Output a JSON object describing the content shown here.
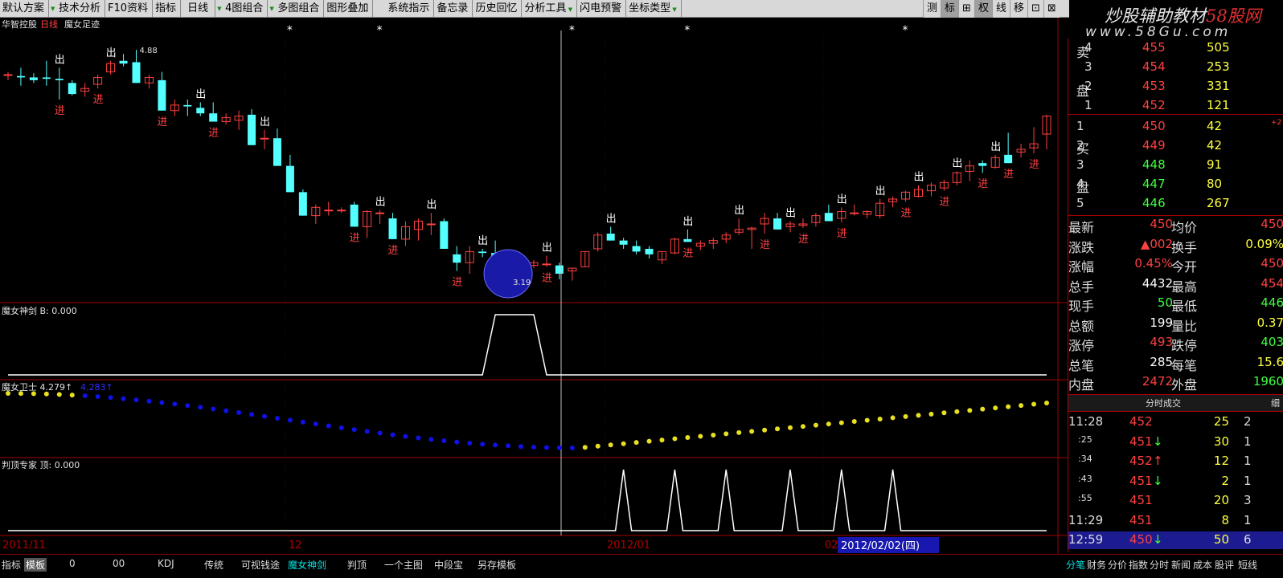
{
  "toolbar": {
    "items": [
      "默认方案",
      "技术分析",
      "F10资料",
      "指标",
      "日线",
      "4图组合",
      "多图组合",
      "图形叠加",
      "系统指示",
      "备忘录",
      "历史回忆",
      "分析工具",
      "闪电预警",
      "坐标类型"
    ],
    "right": [
      "测",
      "标",
      "⊞",
      "权",
      "线",
      "移",
      "⊡",
      "⊠"
    ]
  },
  "brand": {
    "line1a": "炒股辅助教材",
    "line1b": "58股网",
    "line2": "www.58Gu.com"
  },
  "chart": {
    "stock_name": "华智控股",
    "period": "日线",
    "indicator_main": "魔女足迹",
    "high_label": "4.88",
    "low_label": "3.19",
    "panel2_label": "魔女神剑 B: 0.000",
    "panel3_label": "魔女卫士 4.279↑",
    "panel3_label2": "4.283↑",
    "panel4_label": "判顶专家 顶: 0.000",
    "x_labels": [
      "2011/11",
      "12",
      "2012/01",
      "02"
    ],
    "cursor_date": "2012/02/02(四)",
    "out_label": "出",
    "in_label": "进",
    "star_label": "*"
  },
  "chart_data": {
    "type": "candlestick",
    "ohlc": [
      [
        4.7,
        4.72,
        4.66,
        4.7
      ],
      [
        4.69,
        4.75,
        4.62,
        4.68
      ],
      [
        4.68,
        4.71,
        4.64,
        4.66
      ],
      [
        4.68,
        4.8,
        4.62,
        4.67
      ],
      [
        4.67,
        4.75,
        4.52,
        4.66
      ],
      [
        4.64,
        4.66,
        4.55,
        4.56
      ],
      [
        4.58,
        4.64,
        4.54,
        4.6
      ],
      [
        4.63,
        4.7,
        4.6,
        4.68
      ],
      [
        4.72,
        4.8,
        4.7,
        4.78
      ],
      [
        4.8,
        4.85,
        4.76,
        4.78
      ],
      [
        4.79,
        4.88,
        4.64,
        4.64
      ],
      [
        4.64,
        4.7,
        4.6,
        4.68
      ],
      [
        4.66,
        4.72,
        4.44,
        4.44
      ],
      [
        4.44,
        4.52,
        4.4,
        4.48
      ],
      [
        4.48,
        4.52,
        4.4,
        4.47
      ],
      [
        4.46,
        4.5,
        4.4,
        4.42
      ],
      [
        4.42,
        4.5,
        4.36,
        4.36
      ],
      [
        4.36,
        4.42,
        4.34,
        4.39
      ],
      [
        4.37,
        4.44,
        4.3,
        4.4
      ],
      [
        4.41,
        4.45,
        4.19,
        4.19
      ],
      [
        4.24,
        4.3,
        4.16,
        4.24
      ],
      [
        4.24,
        4.31,
        4.04,
        4.04
      ],
      [
        4.04,
        4.12,
        3.85,
        3.85
      ],
      [
        3.85,
        3.87,
        3.68,
        3.68
      ],
      [
        3.68,
        3.76,
        3.62,
        3.74
      ],
      [
        3.72,
        3.78,
        3.68,
        3.72
      ],
      [
        3.72,
        3.74,
        3.7,
        3.72
      ],
      [
        3.76,
        3.78,
        3.6,
        3.6
      ],
      [
        3.6,
        3.72,
        3.52,
        3.71
      ],
      [
        3.7,
        3.72,
        3.62,
        3.7
      ],
      [
        3.66,
        3.7,
        3.51,
        3.51
      ],
      [
        3.51,
        3.64,
        3.46,
        3.6
      ],
      [
        3.58,
        3.66,
        3.5,
        3.64
      ],
      [
        3.62,
        3.7,
        3.54,
        3.62
      ],
      [
        3.64,
        3.66,
        3.44,
        3.44
      ],
      [
        3.4,
        3.46,
        3.28,
        3.34
      ],
      [
        3.34,
        3.46,
        3.26,
        3.42
      ],
      [
        3.42,
        3.44,
        3.38,
        3.41
      ],
      [
        3.41,
        3.5,
        3.29,
        3.29
      ],
      [
        3.26,
        3.28,
        3.19,
        3.26
      ],
      [
        3.26,
        3.36,
        3.24,
        3.34
      ],
      [
        3.32,
        3.36,
        3.3,
        3.34
      ],
      [
        3.33,
        3.39,
        3.31,
        3.33
      ],
      [
        3.32,
        3.34,
        3.22,
        3.26
      ],
      [
        3.28,
        3.3,
        3.21,
        3.3
      ],
      [
        3.31,
        3.42,
        3.31,
        3.42
      ],
      [
        3.44,
        3.56,
        3.42,
        3.54
      ],
      [
        3.55,
        3.6,
        3.5,
        3.5
      ],
      [
        3.5,
        3.52,
        3.44,
        3.47
      ],
      [
        3.46,
        3.5,
        3.4,
        3.42
      ],
      [
        3.44,
        3.46,
        3.37,
        3.4
      ],
      [
        3.36,
        3.42,
        3.33,
        3.42
      ],
      [
        3.41,
        3.52,
        3.4,
        3.51
      ],
      [
        3.51,
        3.58,
        3.49,
        3.49
      ],
      [
        3.46,
        3.5,
        3.43,
        3.48
      ],
      [
        3.48,
        3.52,
        3.44,
        3.5
      ],
      [
        3.51,
        3.56,
        3.48,
        3.54
      ],
      [
        3.56,
        3.66,
        3.54,
        3.58
      ],
      [
        3.58,
        3.6,
        3.44,
        3.59
      ],
      [
        3.62,
        3.7,
        3.55,
        3.66
      ],
      [
        3.66,
        3.7,
        3.58,
        3.58
      ],
      [
        3.6,
        3.64,
        3.56,
        3.62
      ],
      [
        3.61,
        3.66,
        3.59,
        3.62
      ],
      [
        3.63,
        3.7,
        3.6,
        3.68
      ],
      [
        3.7,
        3.76,
        3.64,
        3.64
      ],
      [
        3.66,
        3.74,
        3.63,
        3.71
      ],
      [
        3.7,
        3.76,
        3.68,
        3.7
      ],
      [
        3.69,
        3.72,
        3.66,
        3.71
      ],
      [
        3.68,
        3.8,
        3.66,
        3.77
      ],
      [
        3.78,
        3.82,
        3.74,
        3.8
      ],
      [
        3.8,
        3.86,
        3.78,
        3.85
      ],
      [
        3.82,
        3.9,
        3.81,
        3.87
      ],
      [
        3.86,
        3.92,
        3.82,
        3.9
      ],
      [
        3.88,
        3.94,
        3.86,
        3.92
      ],
      [
        3.92,
        4.0,
        3.9,
        3.99
      ],
      [
        4.0,
        4.08,
        3.93,
        4.04
      ],
      [
        4.06,
        4.08,
        3.99,
        4.04
      ],
      [
        4.03,
        4.12,
        4.02,
        4.1
      ],
      [
        4.12,
        4.28,
        4.06,
        4.06
      ],
      [
        4.14,
        4.2,
        4.1,
        4.16
      ],
      [
        4.17,
        4.32,
        4.13,
        4.2
      ],
      [
        4.27,
        4.41,
        4.16,
        4.4
      ]
    ],
    "sword": [
      0,
      0,
      0,
      0,
      0,
      0,
      0,
      0,
      0,
      0,
      0,
      0,
      0,
      0,
      0,
      0,
      0,
      0,
      0,
      0,
      0,
      0,
      0,
      0,
      0,
      0,
      0,
      0,
      0,
      0,
      0,
      0,
      0,
      0,
      0,
      0,
      0,
      0,
      1,
      1,
      1,
      1,
      0,
      0,
      0,
      0,
      0,
      0,
      0,
      0,
      0,
      0,
      0,
      0,
      0,
      0,
      0,
      0,
      0,
      0,
      0,
      0,
      0,
      0,
      0,
      0,
      0,
      0,
      0,
      0,
      0,
      0,
      0,
      0,
      0,
      0,
      0,
      0,
      0,
      0,
      0,
      0
    ],
    "guard_start": 4.279,
    "guard_end": 4.283,
    "top_spikes": [
      48,
      52,
      56,
      61,
      65,
      69
    ],
    "guard_color_yellow": "#e8e020",
    "guard_color_blue": "#1010e8"
  },
  "quote": {
    "sell_label": "卖盘",
    "buy_label": "买盘",
    "sell": [
      [
        "4",
        "455",
        "505"
      ],
      [
        "3",
        "454",
        "253"
      ],
      [
        "2",
        "453",
        "331"
      ],
      [
        "1",
        "452",
        "121"
      ]
    ],
    "buy": [
      [
        "1",
        "450",
        "42"
      ],
      [
        "2",
        "449",
        "42"
      ],
      [
        "3",
        "448",
        "91"
      ],
      [
        "4",
        "447",
        "80"
      ],
      [
        "5",
        "446",
        "267"
      ]
    ],
    "buy_note": "+2",
    "stats": [
      [
        "最新",
        "450",
        "均价",
        "450"
      ],
      [
        "涨跌",
        "▲002",
        "换手",
        "0.09%"
      ],
      [
        "涨幅",
        "0.45%",
        "今开",
        "450"
      ],
      [
        "总手",
        "4432",
        "最高",
        "454"
      ],
      [
        "现手",
        "50",
        "最低",
        "446"
      ],
      [
        "总额",
        "199",
        "量比",
        "0.37"
      ],
      [
        "涨停",
        "493",
        "跌停",
        "403"
      ],
      [
        "总笔",
        "285",
        "每笔",
        "15.6"
      ],
      [
        "内盘",
        "2472",
        "外盘",
        "1960"
      ]
    ],
    "ticks_header": "分时成交",
    "ticks_header_right": "细",
    "ticks": [
      [
        "11:28",
        "452",
        "",
        "25",
        "2"
      ],
      [
        ":25",
        "451",
        "↓",
        "30",
        "1"
      ],
      [
        ":34",
        "452",
        "↑",
        "12",
        "1"
      ],
      [
        ":43",
        "451",
        "↓",
        "2",
        "1"
      ],
      [
        ":55",
        "451",
        "",
        "20",
        "3"
      ],
      [
        "11:29",
        "451",
        "",
        "8",
        "1"
      ],
      [
        "12:59",
        "450",
        "↓",
        "50",
        "6"
      ]
    ]
  },
  "bottombar": {
    "left": [
      "指标",
      "模板",
      "0",
      "00",
      "KDJ",
      "传统",
      "可视钱途",
      "魔女神剑",
      "判顶",
      "一个主图",
      "中段宝",
      "另存模板"
    ],
    "right": [
      "分笔",
      "财务",
      "分价",
      "指数",
      "分时",
      "新闻",
      "成本",
      "股评",
      "短线"
    ]
  },
  "colors": {
    "up": "#ff4040",
    "down": "#54ffff",
    "border": "#a00000",
    "white": "#ffffff",
    "yellow": "#ffff40",
    "green": "#40ff40"
  }
}
